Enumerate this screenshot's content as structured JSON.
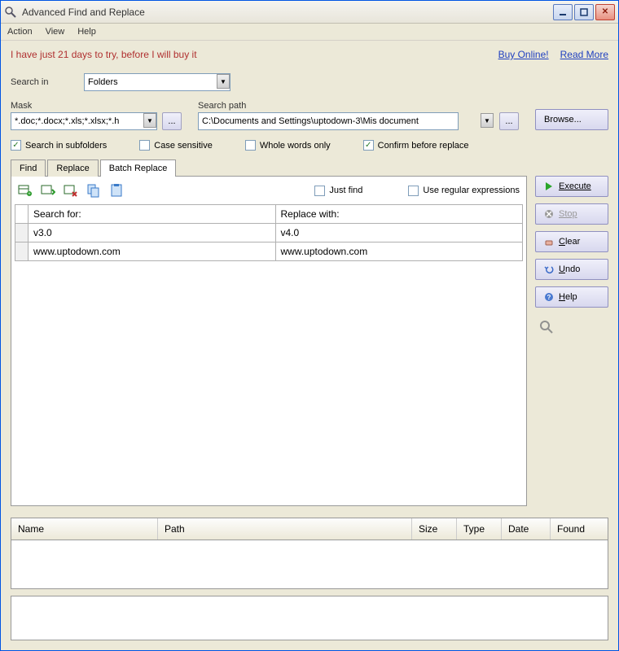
{
  "window": {
    "title": "Advanced Find and Replace"
  },
  "menu": {
    "action": "Action",
    "view": "View",
    "help": "Help"
  },
  "trial": {
    "message": "I have just 21 days to try, before I will buy it",
    "buy": "Buy Online!",
    "read": "Read More"
  },
  "searchin": {
    "label": "Search in",
    "value": "Folders"
  },
  "mask": {
    "label": "Mask",
    "value": "*.doc;*.docx;*.xls;*.xlsx;*.h"
  },
  "searchpath": {
    "label": "Search path",
    "value": "C:\\Documents and Settings\\uptodown-3\\Mis document"
  },
  "browse": "Browse...",
  "ellipsis": "...",
  "checks": {
    "subfolders": "Search in subfolders",
    "case": "Case sensitive",
    "whole": "Whole words only",
    "confirm": "Confirm before replace"
  },
  "tabs": {
    "find": "Find",
    "replace": "Replace",
    "batch": "Batch Replace"
  },
  "toolbar": {
    "justfind": "Just find",
    "regex": "Use regular expressions"
  },
  "grid": {
    "h1": "Search for:",
    "h2": "Replace with:",
    "rows": [
      {
        "s": "v3.0",
        "r": "v4.0"
      },
      {
        "s": "www.uptodown.com",
        "r": "www.uptodown.com"
      }
    ]
  },
  "side": {
    "execute": "Execute",
    "stop": "Stop",
    "clear": "Clear",
    "undo": "Undo",
    "help": "Help"
  },
  "results": {
    "name": "Name",
    "path": "Path",
    "size": "Size",
    "type": "Type",
    "date": "Date",
    "found": "Found"
  }
}
